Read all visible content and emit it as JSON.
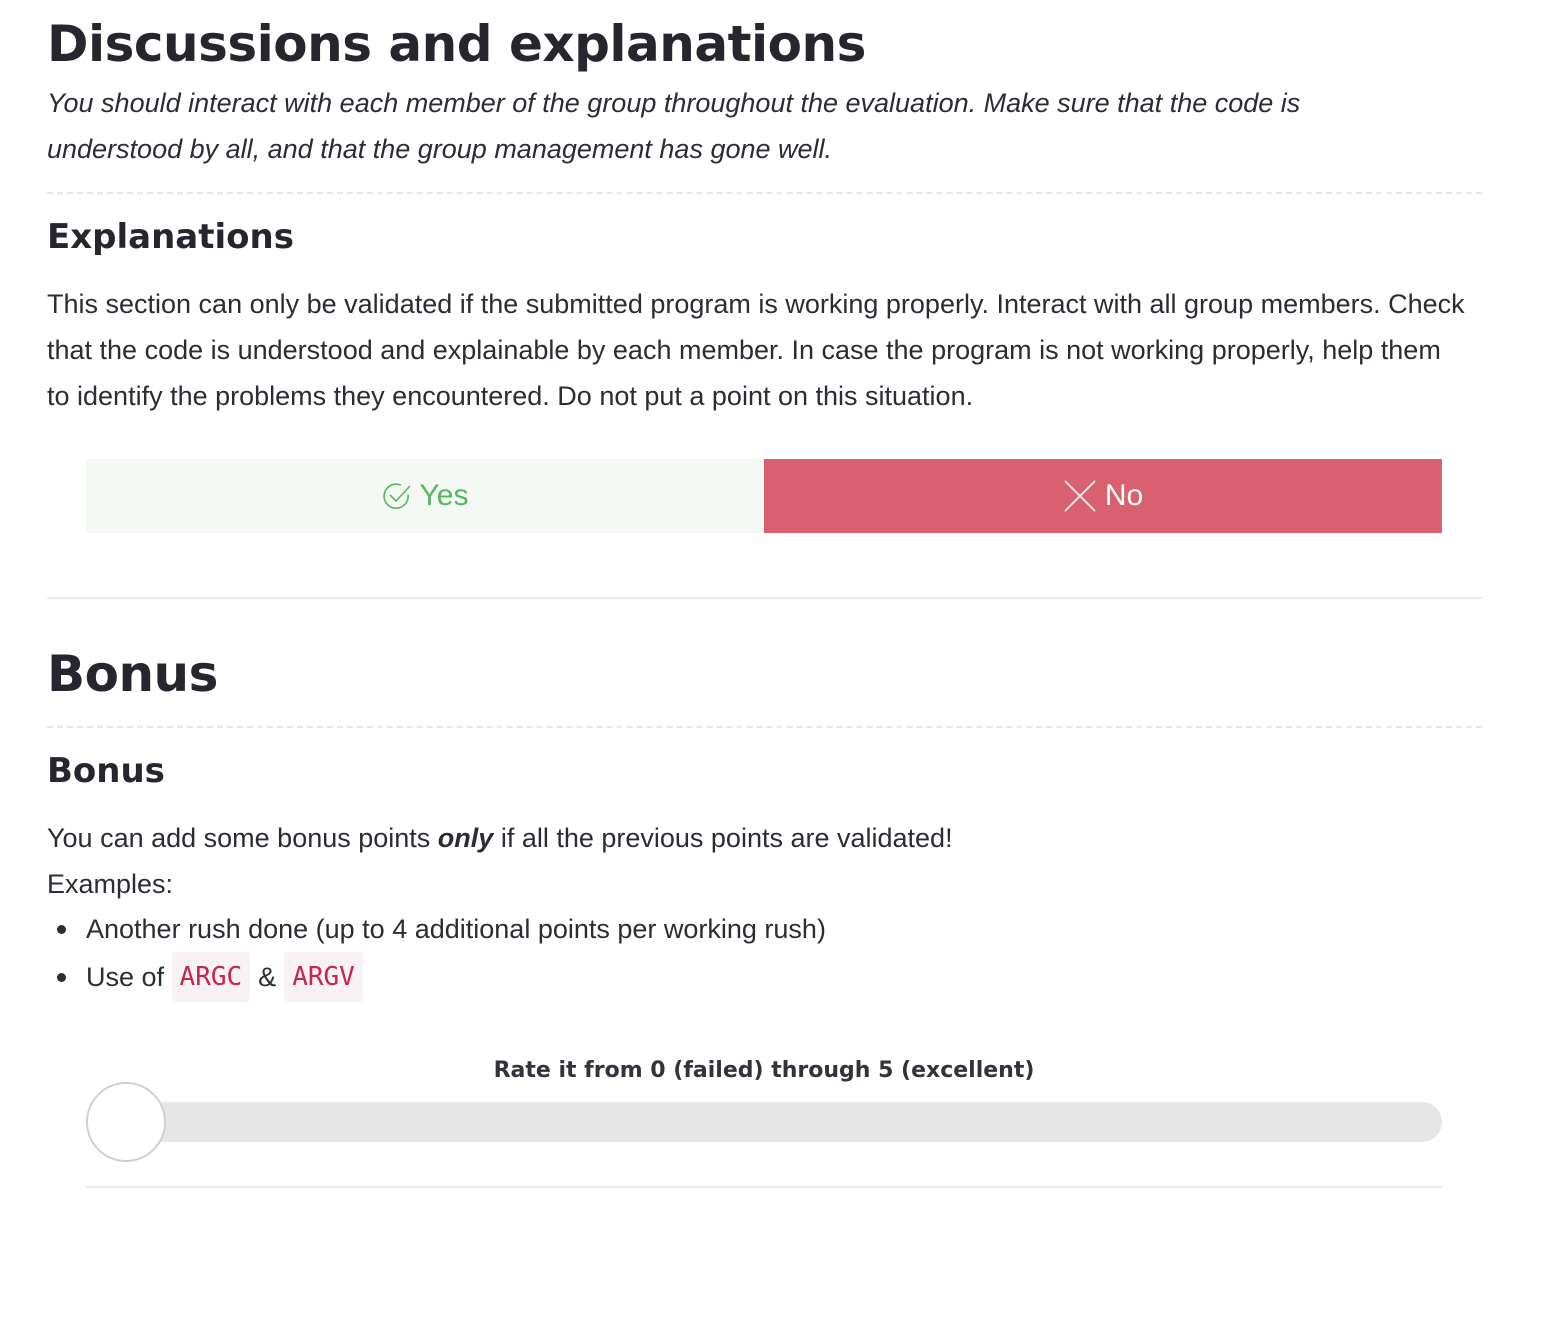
{
  "section1": {
    "title": "Discussions and explanations",
    "description": "You should interact with each member of the group throughout the evaluation. Make sure that the code is understood by all, and that the group management has gone well."
  },
  "explanations": {
    "title": "Explanations",
    "body": "This section can only be validated if the submitted program is working properly. Interact with all group members. Check that the code is understood and explainable by each member. In case the program is not working properly, help them to identify the problems they encountered. Do not put a point on this situation.",
    "yes_label": "Yes",
    "no_label": "No",
    "selected": "No",
    "colors": {
      "yes_text": "#57b660",
      "yes_bg": "#f4f9f4",
      "no_bg": "#d9616f"
    }
  },
  "bonus_section": {
    "title": "Bonus"
  },
  "bonus": {
    "title": "Bonus",
    "text_before": "You can add some bonus points ",
    "text_strong": "only",
    "text_after": " if all the previous points are validated!",
    "examples_label": "Examples:",
    "bullet1": "Another rush done (up to 4 additional points per working rush)",
    "bullet2_prefix": "Use of ",
    "bullet2_code1": "ARGC",
    "bullet2_amp": "&",
    "bullet2_code2": "ARGV",
    "rating_label": "Rate it from 0 (failed) through 5 (excellent)",
    "rating_min": 0,
    "rating_max": 5,
    "rating_value": 0
  }
}
